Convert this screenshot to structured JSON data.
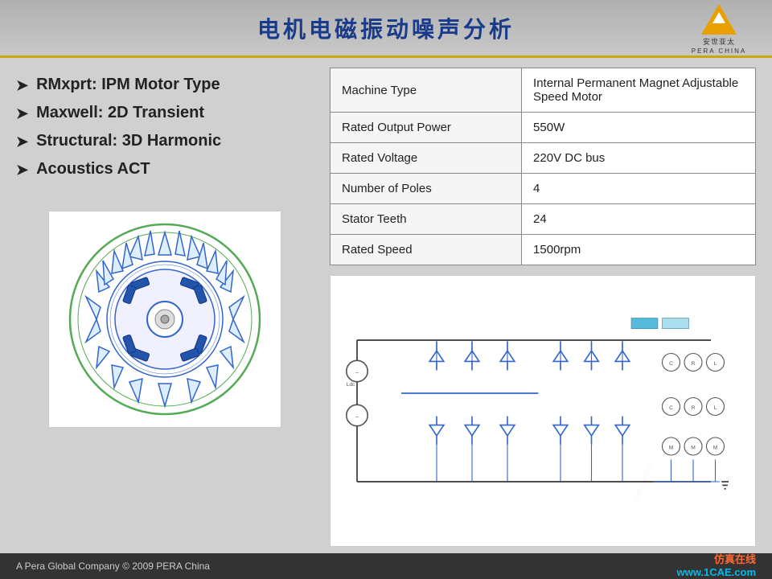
{
  "header": {
    "title": "电机电磁振动噪声分析",
    "logo_company": "安世亚太",
    "logo_sub": "PERA CHINA"
  },
  "left": {
    "bullets": [
      "RMxprt: IPM Motor Type",
      "Maxwell: 2D Transient",
      "Structural: 3D Harmonic",
      "Acoustics ACT"
    ]
  },
  "specs_table": {
    "rows": [
      {
        "label": "Machine Type",
        "value": "Internal Permanent Magnet Adjustable Speed Motor"
      },
      {
        "label": "Rated Output Power",
        "value": "550W"
      },
      {
        "label": "Rated Voltage",
        "value": "220V DC bus"
      },
      {
        "label": "Number of Poles",
        "value": "4"
      },
      {
        "label": "Stator Teeth",
        "value": "24"
      },
      {
        "label": "Rated Speed",
        "value": "1500rpm"
      }
    ]
  },
  "footer": {
    "left": "A Pera Global Company  © 2009 PERA China",
    "right_top": "仿真在线",
    "right_bottom": "www.1CAE.com"
  }
}
